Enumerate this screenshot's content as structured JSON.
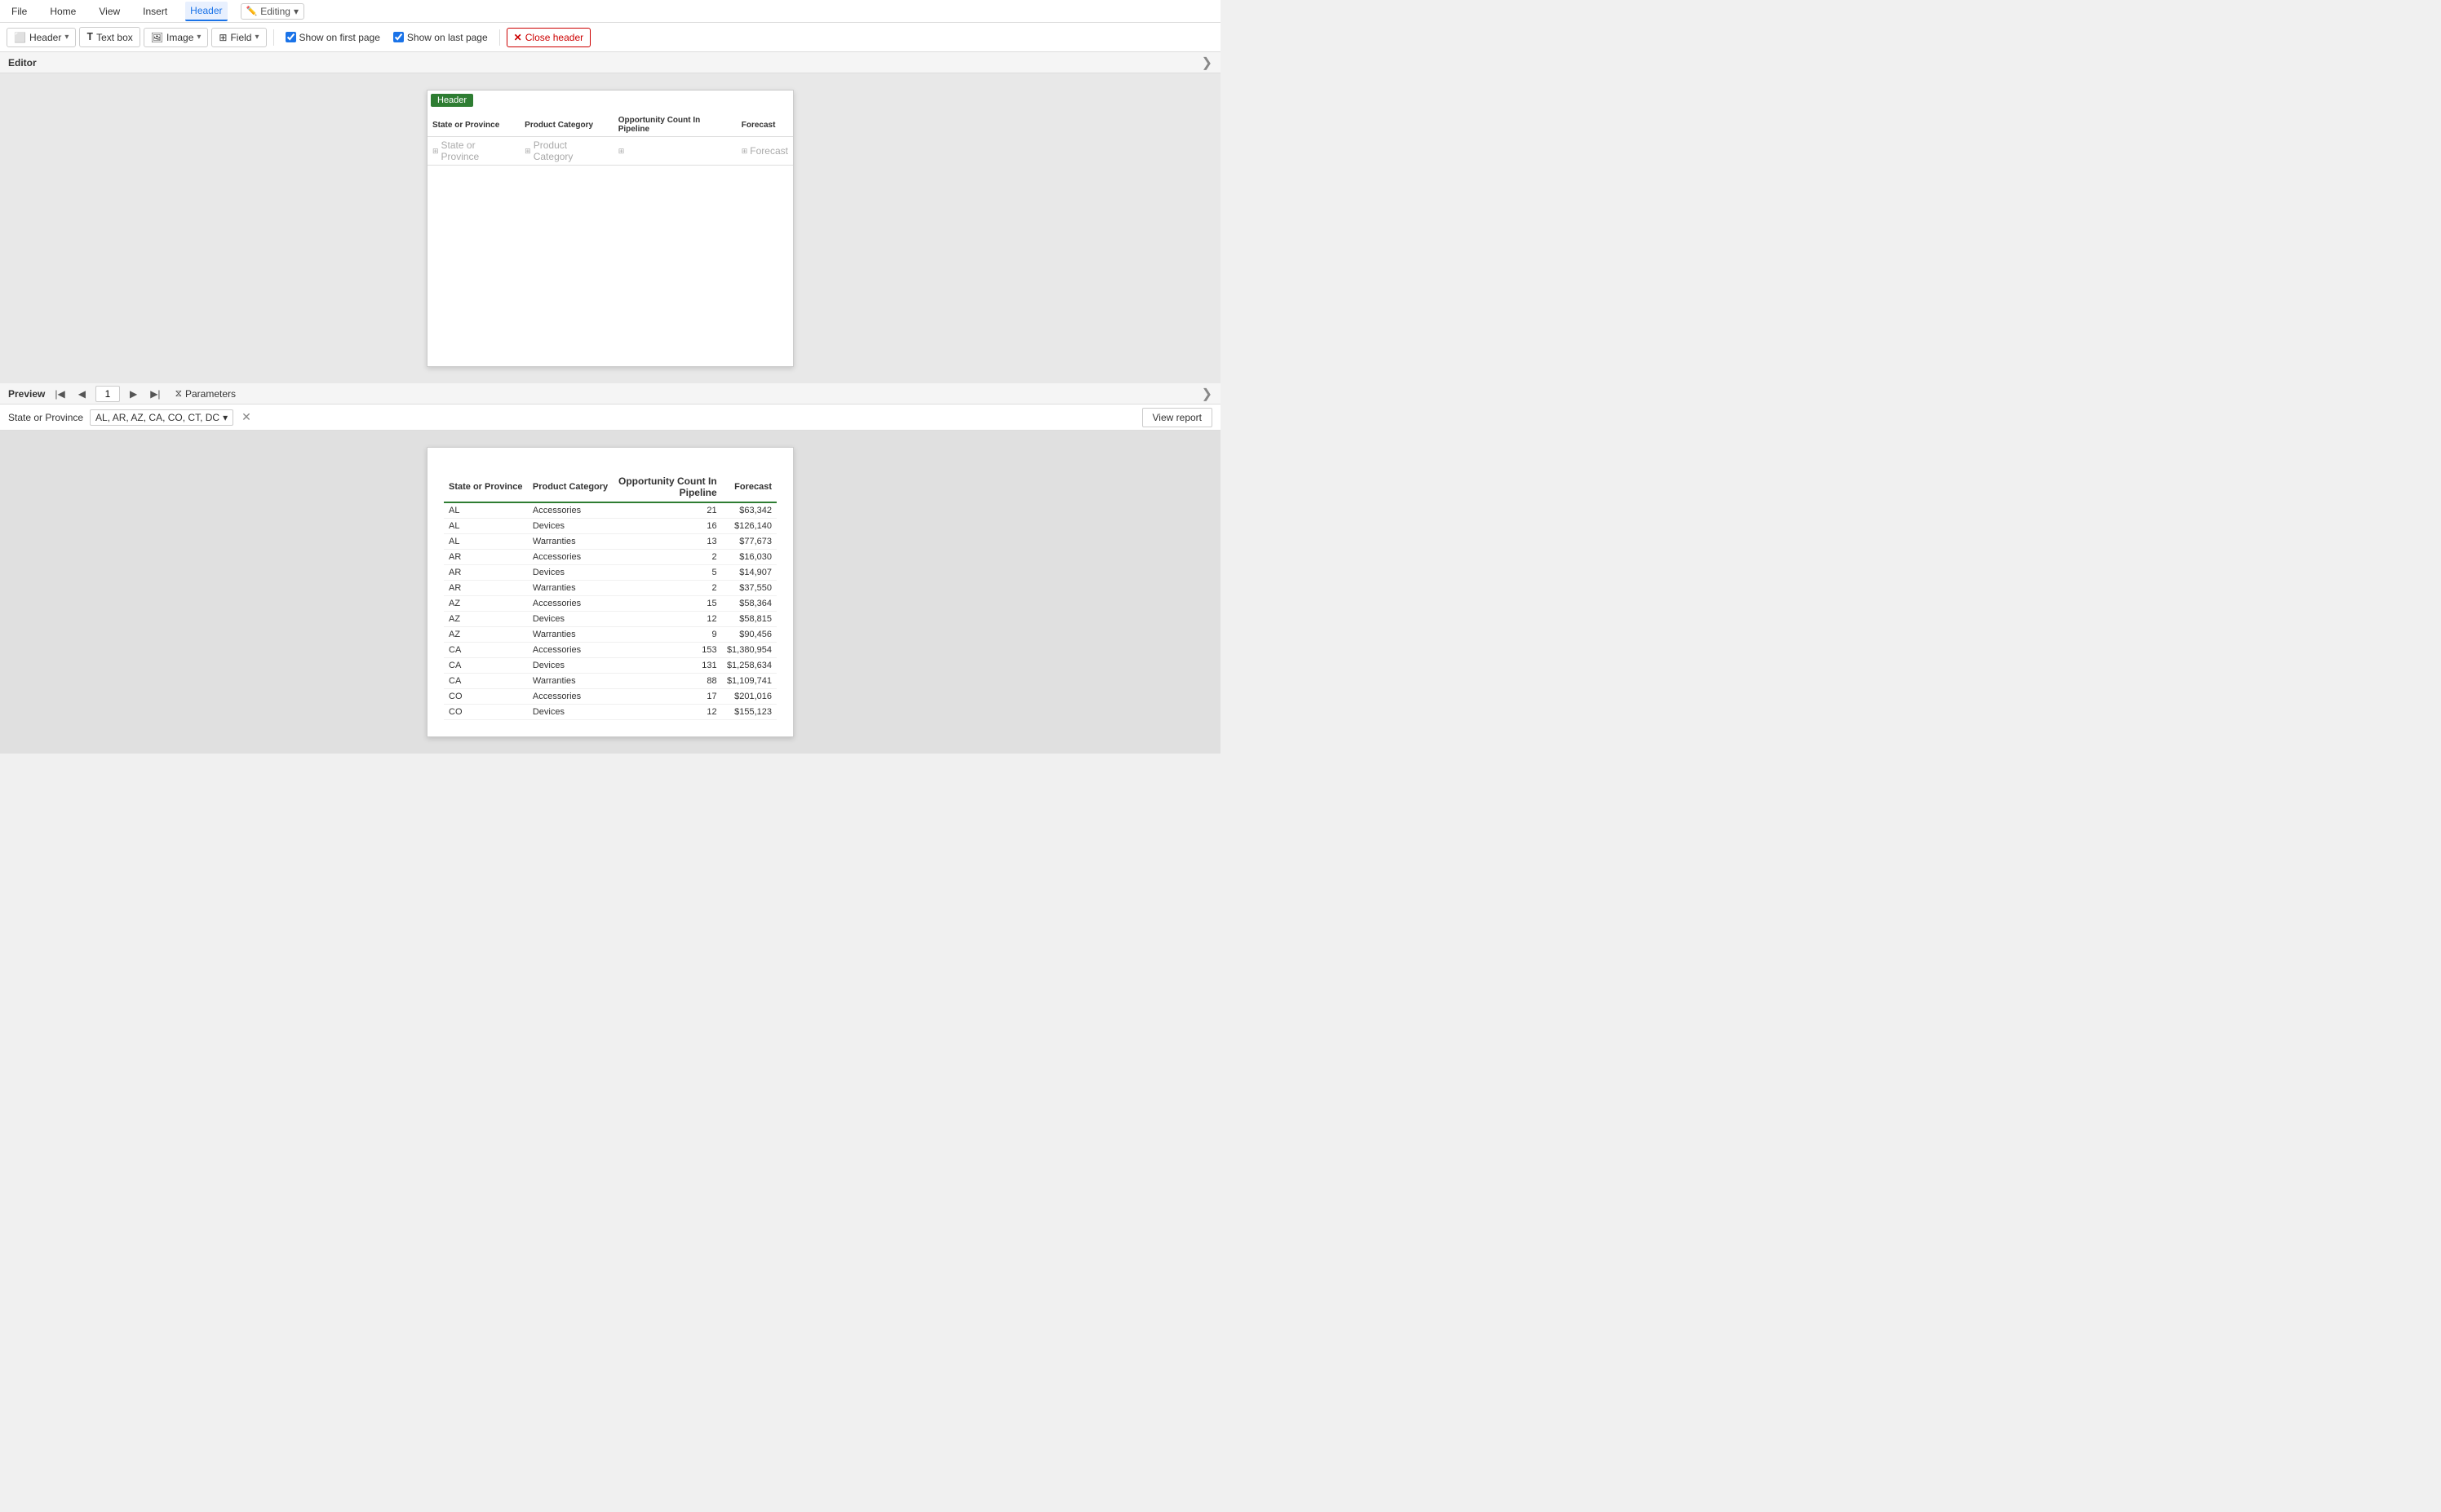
{
  "menubar": {
    "items": [
      {
        "label": "File",
        "active": false
      },
      {
        "label": "Home",
        "active": false
      },
      {
        "label": "View",
        "active": false
      },
      {
        "label": "Insert",
        "active": false
      },
      {
        "label": "Header",
        "active": true
      },
      {
        "label": "Editing",
        "active": false
      }
    ]
  },
  "toolbar": {
    "header_btn": "Header",
    "textbox_btn": "Text box",
    "image_btn": "Image",
    "field_btn": "Field",
    "show_first_label": "Show on first page",
    "show_last_label": "Show on last page",
    "close_header_label": "Close header",
    "show_first_checked": true,
    "show_last_checked": true
  },
  "editor": {
    "title": "Editor",
    "header_badge": "Header",
    "columns": [
      {
        "label": "State or Province"
      },
      {
        "label": "Product Category"
      },
      {
        "label": "Opportunity Count In Pipeline"
      },
      {
        "label": "Forecast"
      }
    ],
    "field_placeholders": [
      "State or Province",
      "Product Category",
      "",
      "Forecast"
    ]
  },
  "preview": {
    "title": "Preview",
    "page_number": "1",
    "parameters_label": "Parameters"
  },
  "params": {
    "label": "State or Province",
    "value": "AL, AR, AZ, CA, CO, CT, DC",
    "view_report_label": "View report"
  },
  "table": {
    "headers": [
      "State or Province",
      "Product Category",
      "Opportunity Count In Pipeline",
      "Forecast"
    ],
    "rows": [
      [
        "AL",
        "Accessories",
        "21",
        "$63,342"
      ],
      [
        "AL",
        "Devices",
        "16",
        "$126,140"
      ],
      [
        "AL",
        "Warranties",
        "13",
        "$77,673"
      ],
      [
        "AR",
        "Accessories",
        "2",
        "$16,030"
      ],
      [
        "AR",
        "Devices",
        "5",
        "$14,907"
      ],
      [
        "AR",
        "Warranties",
        "2",
        "$37,550"
      ],
      [
        "AZ",
        "Accessories",
        "15",
        "$58,364"
      ],
      [
        "AZ",
        "Devices",
        "12",
        "$58,815"
      ],
      [
        "AZ",
        "Warranties",
        "9",
        "$90,456"
      ],
      [
        "CA",
        "Accessories",
        "153",
        "$1,380,954"
      ],
      [
        "CA",
        "Devices",
        "131",
        "$1,258,634"
      ],
      [
        "CA",
        "Warranties",
        "88",
        "$1,109,741"
      ],
      [
        "CO",
        "Accessories",
        "17",
        "$201,016"
      ],
      [
        "CO",
        "Devices",
        "12",
        "$155,123"
      ]
    ]
  }
}
